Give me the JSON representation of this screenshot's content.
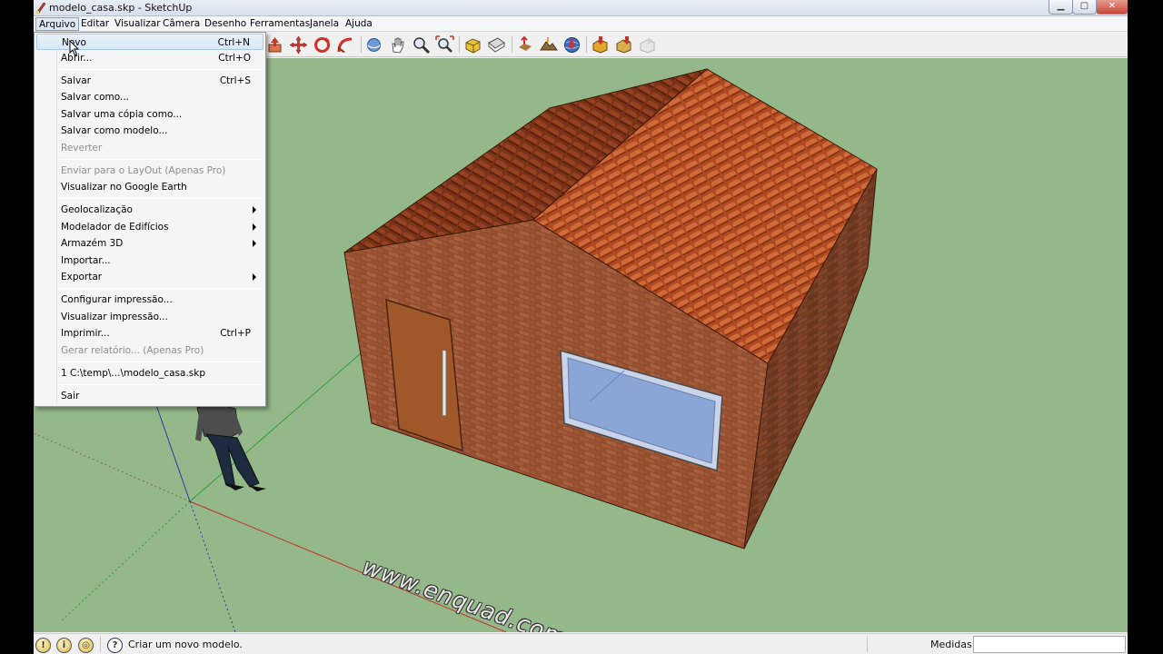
{
  "window": {
    "title": "modelo_casa.skp - SketchUp",
    "controls": {
      "minimize": "▁",
      "maximize": "▢",
      "close": "✕"
    }
  },
  "menubar": {
    "items": [
      "Arquivo",
      "Editar",
      "Visualizar",
      "Câmera",
      "Desenho",
      "Ferramentas",
      "Janela",
      "Ajuda"
    ],
    "active": "Arquivo"
  },
  "file_menu": {
    "items": [
      {
        "label": "Novo",
        "shortcut": "Ctrl+N",
        "state": "hover"
      },
      {
        "label": "Abrir...",
        "shortcut": "Ctrl+O"
      },
      {
        "label": "Salvar",
        "shortcut": "Ctrl+S"
      },
      {
        "label": "Salvar como...",
        "shortcut": ""
      },
      {
        "label": "Salvar uma cópia como...",
        "shortcut": ""
      },
      {
        "label": "Salvar como modelo...",
        "shortcut": ""
      },
      {
        "label": "Reverter",
        "shortcut": "",
        "state": "disabled"
      },
      {
        "label": "Enviar para o LayOut (Apenas Pro)",
        "shortcut": "",
        "state": "disabled"
      },
      {
        "label": "Visualizar no Google Earth",
        "shortcut": ""
      },
      {
        "label": "Geolocalização",
        "submenu": true
      },
      {
        "label": "Modelador de Edifícios",
        "submenu": true
      },
      {
        "label": "Armazém 3D",
        "submenu": true
      },
      {
        "label": "Importar...",
        "shortcut": ""
      },
      {
        "label": "Exportar",
        "submenu": true
      },
      {
        "label": "Configurar impressão...",
        "shortcut": ""
      },
      {
        "label": "Visualizar impressão...",
        "shortcut": ""
      },
      {
        "label": "Imprimir...",
        "shortcut": "Ctrl+P"
      },
      {
        "label": "Gerar relatório... (Apenas Pro)",
        "shortcut": "",
        "state": "disabled"
      },
      {
        "label": "1 C:\\temp\\...\\modelo_casa.skp",
        "shortcut": ""
      },
      {
        "label": "Sair",
        "shortcut": ""
      }
    ]
  },
  "toolbar": {
    "icons": [
      "push-pull-icon",
      "move-icon",
      "rotate-icon",
      "follow-me-icon",
      "orbit-icon",
      "pan-icon",
      "zoom-icon",
      "zoom-extents-icon",
      "iso-view-icon",
      "top-view-icon",
      "add-location-icon",
      "toggle-terrain-icon",
      "get-models-icon",
      "share-model-icon",
      "share-component-icon",
      "extension-warehouse-icon"
    ]
  },
  "viewport": {
    "background": "#94b88a",
    "watermark": "www.enquad.com.br"
  },
  "statusbar": {
    "icons": [
      "geo-location-icon",
      "credits-icon",
      "login-icon",
      "help-icon"
    ],
    "message": "Criar um novo modelo.",
    "measure_label": "Medidas",
    "measure_value": ""
  }
}
